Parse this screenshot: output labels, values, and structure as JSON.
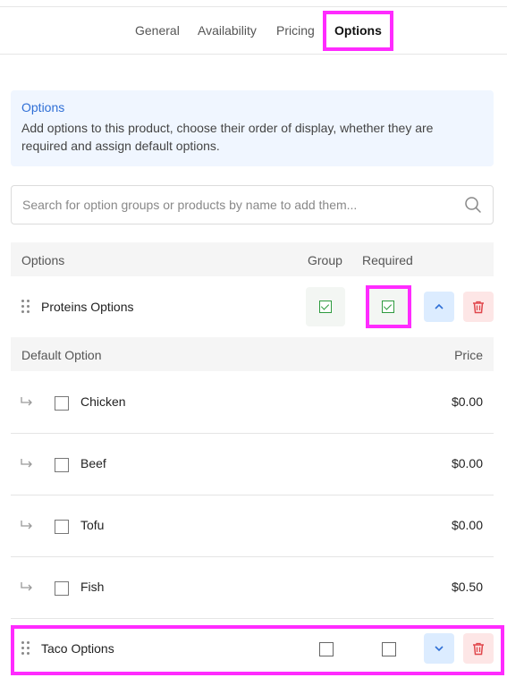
{
  "tabs": [
    {
      "label": "General",
      "active": false
    },
    {
      "label": "Availability",
      "active": false
    },
    {
      "label": "Pricing",
      "active": false
    },
    {
      "label": "Options",
      "active": true
    }
  ],
  "info": {
    "title": "Options",
    "text": "Add options to this product, choose their order of display, whether they are required and assign default options."
  },
  "search": {
    "placeholder": "Search for option groups or products by name to add them..."
  },
  "table": {
    "headers": {
      "options": "Options",
      "group": "Group",
      "required": "Required"
    },
    "sub_headers": {
      "default_option": "Default Option",
      "price": "Price"
    },
    "groups": [
      {
        "name": "Proteins Options",
        "group": true,
        "required": true,
        "options": [
          {
            "name": "Chicken",
            "price": "$0.00",
            "default": false
          },
          {
            "name": "Beef",
            "price": "$0.00",
            "default": false
          },
          {
            "name": "Tofu",
            "price": "$0.00",
            "default": false
          },
          {
            "name": "Fish",
            "price": "$0.50",
            "default": false
          }
        ]
      },
      {
        "name": "Taco Options",
        "group": false,
        "required": false
      }
    ]
  },
  "colors": {
    "accent": "#2f6fd6",
    "highlight": "#ff2bff",
    "check_green": "#2e9b3f",
    "delete_red": "#e0474c"
  }
}
